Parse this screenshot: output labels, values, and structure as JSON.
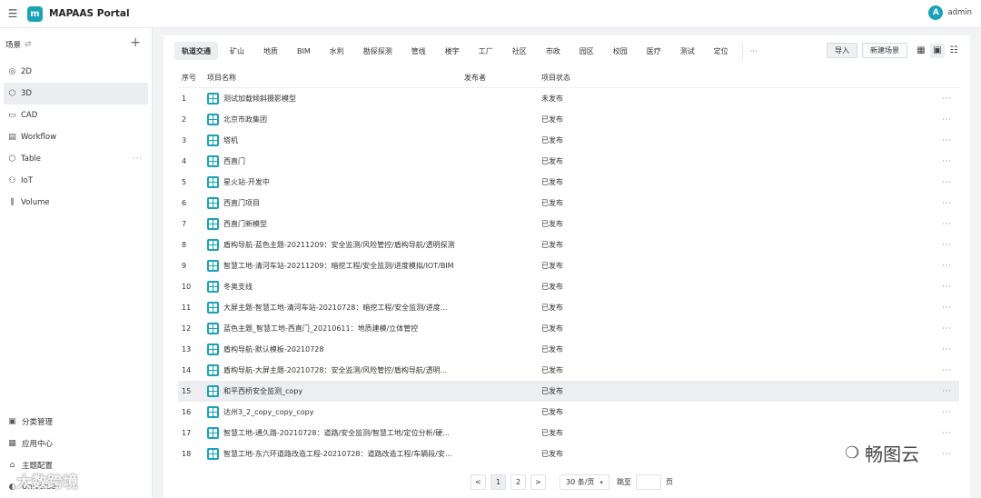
{
  "app": {
    "title": "MAPAAS Portal",
    "logo_letter": "m",
    "user_initial": "A",
    "user_name": "admin"
  },
  "sidebar": {
    "header": "场景",
    "items": [
      {
        "label": "2D",
        "icon": "globe-icon",
        "glyph": "◎"
      },
      {
        "label": "3D",
        "icon": "cube-icon",
        "glyph": "⬡",
        "active": true
      },
      {
        "label": "CAD",
        "icon": "cad-icon",
        "glyph": "▭"
      },
      {
        "label": "Workflow",
        "icon": "workflow-icon",
        "glyph": "▤"
      },
      {
        "label": "Table",
        "icon": "table-icon",
        "glyph": "⬡"
      },
      {
        "label": "IoT",
        "icon": "iot-icon",
        "glyph": "⚇"
      },
      {
        "label": "Volume",
        "icon": "volume-icon",
        "glyph": "⫼"
      }
    ],
    "bottom": [
      {
        "label": "分类管理",
        "icon": "category-icon",
        "glyph": "▣"
      },
      {
        "label": "应用中心",
        "icon": "app-center-icon",
        "glyph": "▦"
      },
      {
        "label": "主题配置",
        "icon": "theme-icon",
        "glyph": "⌂"
      },
      {
        "label": "Universe",
        "icon": "universe-icon",
        "glyph": "◐"
      }
    ]
  },
  "tabs": [
    "轨道交通",
    "矿山",
    "地质",
    "BIM",
    "水利",
    "勘探探测",
    "管线",
    "楼宇",
    "工厂",
    "社区",
    "市政",
    "园区",
    "校园",
    "医疗",
    "测试",
    "定位"
  ],
  "tab_more": "···",
  "toolbar": {
    "import": "导入",
    "new_scene": "新建场景"
  },
  "table": {
    "headers": {
      "index": "序号",
      "name": "项目名称",
      "publisher": "发布者",
      "status": "项目状态"
    },
    "rows": [
      {
        "index": "1",
        "name": "测试加载倾斜摄影模型",
        "publisher": "",
        "status": "未发布"
      },
      {
        "index": "2",
        "name": "北京市政集团",
        "publisher": "",
        "status": "已发布"
      },
      {
        "index": "3",
        "name": "塔机",
        "publisher": "",
        "status": "已发布"
      },
      {
        "index": "4",
        "name": "西直门",
        "publisher": "",
        "status": "已发布"
      },
      {
        "index": "5",
        "name": "星火站-开发中",
        "publisher": "",
        "status": "已发布"
      },
      {
        "index": "6",
        "name": "西直门项目",
        "publisher": "",
        "status": "已发布"
      },
      {
        "index": "7",
        "name": "西直门新模型",
        "publisher": "",
        "status": "已发布"
      },
      {
        "index": "8",
        "name": "盾构导航-蓝色主题-20211209：安全监测/风险管控/盾构导航/透明探测",
        "publisher": "",
        "status": "已发布"
      },
      {
        "index": "9",
        "name": "智慧工地-清河车站-20211209：暗挖工程/安全监测/进度模拟/IOT/BIM",
        "publisher": "",
        "status": "已发布"
      },
      {
        "index": "10",
        "name": "冬奥支线",
        "publisher": "",
        "status": "已发布"
      },
      {
        "index": "11",
        "name": "大屏主题-智慧工地-清河车站-20210728：暗挖工程/安全监测/进度...",
        "publisher": "",
        "status": "已发布"
      },
      {
        "index": "12",
        "name": "蓝色主题_智慧工地-西直门_20210611：地质建模/立体管控",
        "publisher": "",
        "status": "已发布"
      },
      {
        "index": "13",
        "name": "盾构导航-默认模板-20210728",
        "publisher": "",
        "status": "已发布"
      },
      {
        "index": "14",
        "name": "盾构导航-大屏主题-20210728：安全监测/风险管控/盾构导航/透明...",
        "publisher": "",
        "status": "已发布"
      },
      {
        "index": "15",
        "name": "和平西桥安全监测_copy",
        "publisher": "",
        "status": "已发布",
        "highlight": true
      },
      {
        "index": "16",
        "name": "达州3_2_copy_copy_copy",
        "publisher": "",
        "status": "已发布"
      },
      {
        "index": "17",
        "name": "智慧工地-通久路-20210728：道路/安全监测/智慧工地/定位分析/硬...",
        "publisher": "",
        "status": "已发布"
      },
      {
        "index": "18",
        "name": "智慧工地-东六环道路改造工程-20210728：道路改造工程/车辆段/安...",
        "publisher": "",
        "status": "已发布"
      }
    ],
    "row_action": "···"
  },
  "pagination": {
    "prev": "<",
    "pages": [
      "1",
      "2"
    ],
    "current": "1",
    "next": ">",
    "page_size": "30 条/页",
    "jump_label": "跳至",
    "page_unit": "页"
  },
  "watermarks": {
    "left": "大数跨境",
    "right": "畅图云"
  },
  "colors": {
    "accent": "#1aa3b8",
    "row_highlight": "#eceef1"
  }
}
